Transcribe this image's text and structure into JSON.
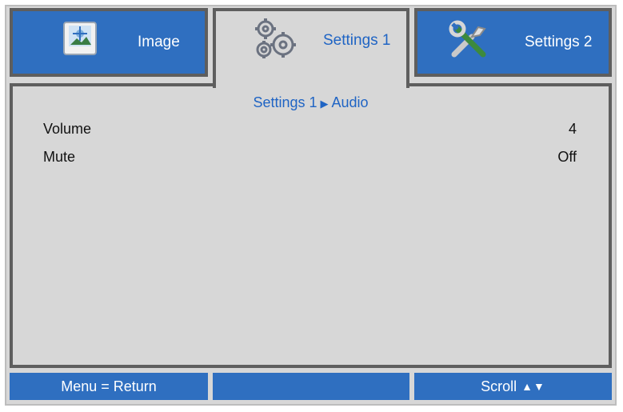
{
  "tabs": {
    "image": {
      "label": "Image",
      "icon": "image-settings-icon"
    },
    "settings1": {
      "label": "Settings 1",
      "icon": "gears-icon",
      "active": true
    },
    "settings2": {
      "label": "Settings 2",
      "icon": "tools-icon"
    }
  },
  "breadcrumb": {
    "parent": "Settings 1",
    "separator_icon": "triangle-right-icon",
    "current": "Audio"
  },
  "settings": [
    {
      "label": "Volume",
      "value": "4"
    },
    {
      "label": "Mute",
      "value": "Off"
    }
  ],
  "footer": {
    "left_label": "Menu = Return",
    "middle_label": "",
    "right_label": "Scroll",
    "right_icons": "up-down-arrows-icon"
  },
  "colors": {
    "tab_blue": "#2f6fc0",
    "accent_text": "#1f64c4",
    "panel_gray": "#d7d7d7",
    "border_dark": "#5e5e5e"
  }
}
